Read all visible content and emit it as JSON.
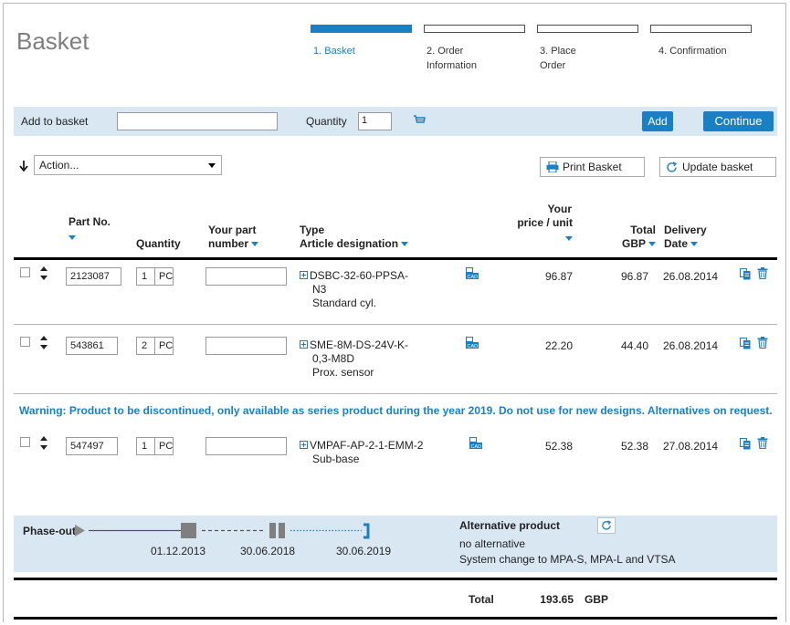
{
  "page": {
    "title": "Basket"
  },
  "steps": [
    {
      "label": "1. Basket",
      "active": true
    },
    {
      "label": "2. Order Information",
      "active": false
    },
    {
      "label": "3. Place Order",
      "active": false
    },
    {
      "label": "4. Confirmation",
      "active": false
    }
  ],
  "add_bar": {
    "add_to_basket_label": "Add to basket",
    "part_input_value": "",
    "quantity_label": "Quantity",
    "quantity_value": "1",
    "add_button": "Add",
    "continue_button": "Continue"
  },
  "toolbar": {
    "action_select": "Action...",
    "print_button": "Print Basket",
    "update_button": "Update basket"
  },
  "table": {
    "headers": {
      "part_no": "Part No.",
      "quantity": "Quantity",
      "your_part_line1": "Your part",
      "your_part_line2": "number",
      "type_line1": "Type",
      "type_line2": "Article designation",
      "price_line1": "Your",
      "price_line2": "price / unit",
      "total_line1": "Total",
      "total_line2": "GBP",
      "delivery_line1": "Delivery",
      "delivery_line2": "Date"
    },
    "rows": [
      {
        "part_no": "2123087",
        "qty": "1",
        "unit": "PC",
        "your_part": "",
        "type_l1": "DSBC-32-60-PPSA-",
        "type_l2": "N3",
        "type_l3": "Standard cyl.",
        "price": "96.87",
        "total": "96.87",
        "delivery": "26.08.2014"
      },
      {
        "part_no": "543861",
        "qty": "2",
        "unit": "PC",
        "your_part": "",
        "type_l1": "SME-8M-DS-24V-K-",
        "type_l2": "0,3-M8D",
        "type_l3": "Prox. sensor",
        "price": "22.20",
        "total": "44.40",
        "delivery": "26.08.2014"
      },
      {
        "part_no": "547497",
        "qty": "1",
        "unit": "PC",
        "your_part": "",
        "type_l1": "VMPAF-AP-2-1-EMM-2",
        "type_l2": "Sub-base",
        "type_l3": "",
        "price": "52.38",
        "total": "52.38",
        "delivery": "27.08.2014"
      }
    ],
    "warning": "Warning: Product to be discontinued, only available as series product during the year 2019. Do not use for new designs. Alternatives on request."
  },
  "phase_out": {
    "label": "Phase-out",
    "date1": "01.12.2013",
    "date2": "30.06.2018",
    "date3": "30.06.2019",
    "alt_title": "Alternative product",
    "alt_line1": "no alternative",
    "alt_line2": "System change to MPA-S, MPA-L and VTSA"
  },
  "total": {
    "label": "Total",
    "value": "193.65",
    "currency": "GBP"
  },
  "colors": {
    "accent": "#1a80c4",
    "bar_bg": "#d9e7f3"
  }
}
